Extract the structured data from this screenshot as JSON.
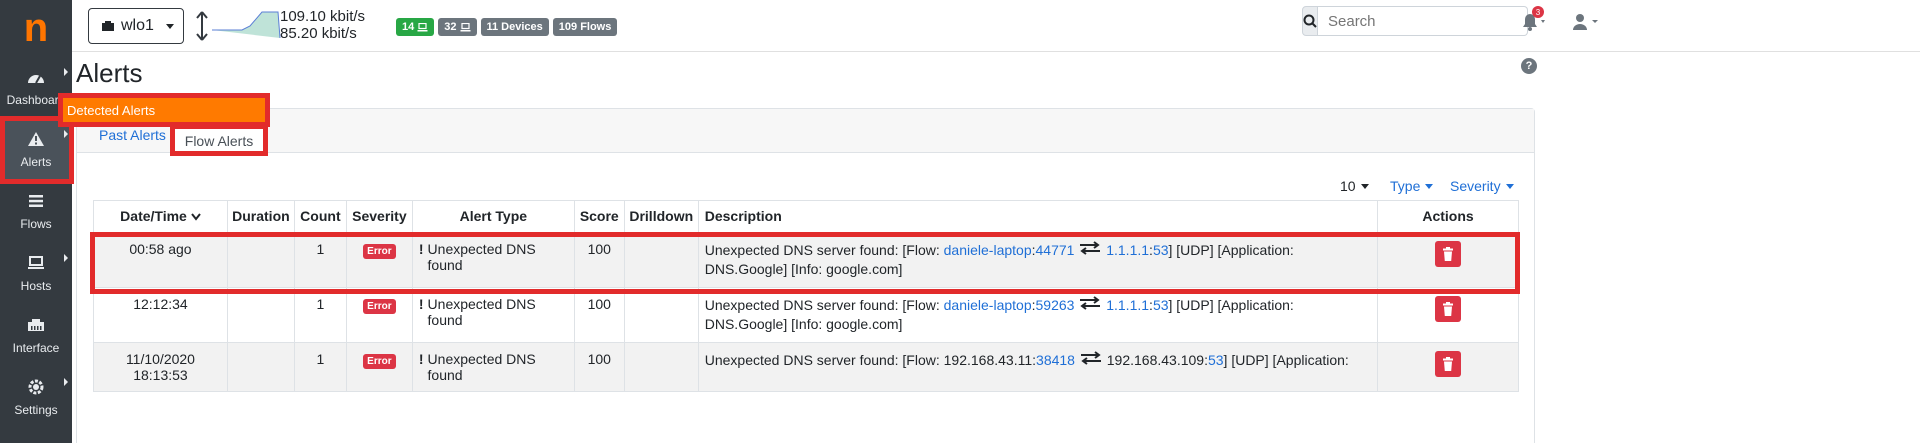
{
  "sidebar": {
    "logo": "n",
    "items": [
      {
        "label": "Dashboard"
      },
      {
        "label": "Alerts"
      },
      {
        "label": "Flows"
      },
      {
        "label": "Hosts"
      },
      {
        "label": "Interface"
      },
      {
        "label": "Settings"
      }
    ]
  },
  "topbar": {
    "interface": "wlo1",
    "traffic_up": "109.10 kbit/s",
    "traffic_down": "85.20 kbit/s",
    "badges": [
      {
        "label": "14",
        "color": "#28a745"
      },
      {
        "label": "32",
        "color": "#6c757d"
      },
      {
        "label": "11 Devices",
        "color": "#6c757d"
      },
      {
        "label": "109 Flows",
        "color": "#6c757d"
      }
    ],
    "search_placeholder": "Search",
    "notification_count": "3"
  },
  "page": {
    "title": "Alerts",
    "detected_alerts": "Detected Alerts",
    "tabs": [
      {
        "label": "Past Alerts"
      },
      {
        "label": "Flow Alerts"
      }
    ],
    "filters": {
      "page_size": "10",
      "type": "Type",
      "severity": "Severity"
    }
  },
  "table": {
    "columns": [
      "Date/Time",
      "Duration",
      "Count",
      "Severity",
      "Alert Type",
      "Score",
      "Drilldown",
      "Description",
      "Actions"
    ],
    "rows": [
      {
        "datetime": "00:58 ago",
        "duration": "",
        "count": "1",
        "severity": "Error",
        "alert_type": "Unexpected DNS found",
        "score": "100",
        "desc_prefix": "Unexpected DNS server found: [Flow: ",
        "src_host": "daniele-laptop",
        "src_port": "44771",
        "dst_host": "1.1.1.1",
        "dst_port": "53",
        "desc_suffix": "] [UDP] [Application: DNS.Google] [Info: google.com]"
      },
      {
        "datetime": "12:12:34",
        "duration": "",
        "count": "1",
        "severity": "Error",
        "alert_type": "Unexpected DNS found",
        "score": "100",
        "desc_prefix": "Unexpected DNS server found: [Flow: ",
        "src_host": "daniele-laptop",
        "src_port": "59263",
        "dst_host": "1.1.1.1",
        "dst_port": "53",
        "desc_suffix": "] [UDP] [Application: DNS.Google] [Info: google.com]"
      },
      {
        "datetime": "11/10/2020 18:13:53",
        "duration": "",
        "count": "1",
        "severity": "Error",
        "alert_type": "Unexpected DNS found",
        "score": "100",
        "desc_prefix": "Unexpected DNS server found: [Flow: ",
        "src_host": "192.168.43.11",
        "src_port": "38418",
        "dst_host": "192.168.43.109",
        "dst_port": "53",
        "desc_suffix": "] [UDP] [Application:"
      }
    ]
  },
  "colors": {
    "brand": "#ff7500",
    "sidebar_bg": "#343a40",
    "highlight": "#e22b2b",
    "link": "#1f6fd6",
    "danger": "#dc3545"
  }
}
